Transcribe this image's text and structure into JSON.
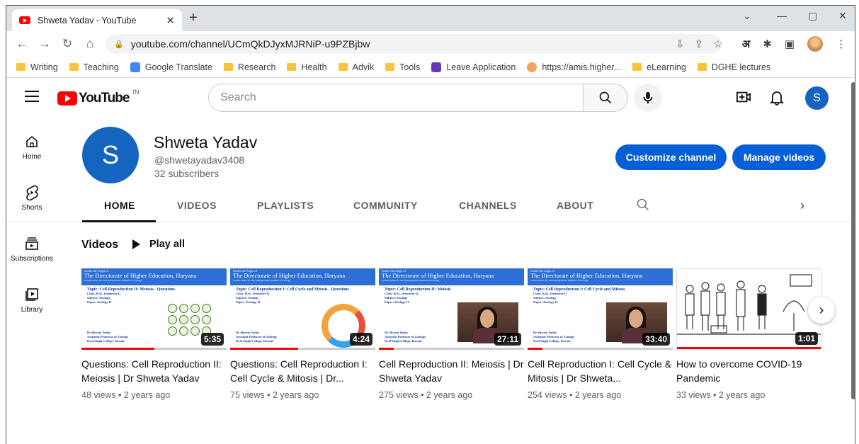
{
  "browser": {
    "tab_title": "Shweta Yadav - YouTube",
    "url": "youtube.com/channel/UCmQkDJyxMJRNiP-u9PZBjbw",
    "ext_lang": "अ",
    "bookmarks": [
      {
        "label": "Writing",
        "icon": "folder-icon"
      },
      {
        "label": "Teaching",
        "icon": "folder-icon"
      },
      {
        "label": "Google Translate",
        "icon": "google-translate-icon"
      },
      {
        "label": "Research",
        "icon": "folder-icon"
      },
      {
        "label": "Health",
        "icon": "folder-icon"
      },
      {
        "label": "Advik",
        "icon": "folder-icon"
      },
      {
        "label": "Tools",
        "icon": "folder-icon"
      },
      {
        "label": "Leave Application",
        "icon": "forms-icon"
      },
      {
        "label": "https://amis.higher...",
        "icon": "site-icon"
      },
      {
        "label": "eLearning",
        "icon": "folder-icon"
      },
      {
        "label": "DGHE lectures",
        "icon": "folder-icon"
      }
    ]
  },
  "header": {
    "logo_text": "YouTube",
    "country_code": "IN",
    "search_placeholder": "Search",
    "user_initial": "S"
  },
  "guide": {
    "items": [
      {
        "label": "Home",
        "icon": "home-icon"
      },
      {
        "label": "Shorts",
        "icon": "shorts-icon"
      },
      {
        "label": "Subscriptions",
        "icon": "subscriptions-icon"
      },
      {
        "label": "Library",
        "icon": "library-icon"
      }
    ]
  },
  "channel": {
    "initial": "S",
    "name": "Shweta Yadav",
    "handle": "@shwetayadav3408",
    "subscribers": "32 subscribers",
    "customize_label": "Customize channel",
    "manage_label": "Manage videos",
    "tabs": [
      "HOME",
      "VIDEOS",
      "PLAYLISTS",
      "COMMUNITY",
      "CHANNELS",
      "ABOUT"
    ],
    "active_tab": "HOME"
  },
  "shelf": {
    "title": "Videos",
    "play_all": "Play all",
    "videos": [
      {
        "title": "Questions: Cell Reproduction II: Meiosis | Dr Shweta Yadav",
        "views": "48 views",
        "age": "2 years ago",
        "duration": "5:35",
        "watched_fraction": 0.5,
        "slide": {
          "org_pre": "Under the Aegis of",
          "org": "The Directorate of Higher Education, Haryana",
          "series": "Lecture Series for the Undergraduate Students of Zoology",
          "topic": "Topic: Cell Reproduction II: Meiosis - Questions",
          "class": "Class: B.Sc. (Semester I)",
          "subject": "Subject: Zoology",
          "paper": "Paper: Zoology II",
          "author": "Dr Shweta Yadav",
          "role": "Assistant Professor of Zoology",
          "college": "Dyal Singh College, Karnal"
        }
      },
      {
        "title": "Questions: Cell Reproduction I: Cell Cycle & Mitosis | Dr...",
        "views": "75 views",
        "age": "2 years ago",
        "duration": "4:24",
        "watched_fraction": 0.47,
        "slide": {
          "org_pre": "Under the Aegis of",
          "org": "The Directorate of Higher Education, Haryana",
          "series": "Lecture Series for the Undergraduate Students of Zoology",
          "topic": "Topic: Cell Reproduction I: Cell Cycle and Mitosis - Questions",
          "class": "Class: B.Sc. (Semester I)",
          "subject": "Subject: Zoology",
          "paper": "Paper: Zoology II",
          "author": "Dr Shweta Yadav",
          "role": "Assistant Professor of Zoology",
          "college": "Dyal Singh College, Karnal"
        }
      },
      {
        "title": "Cell Reproduction II: Meiosis | Dr Shweta Yadav",
        "views": "275 views",
        "age": "2 years ago",
        "duration": "27:11",
        "watched_fraction": 0.1,
        "slide": {
          "org_pre": "Under the Aegis of",
          "org": "The Directorate of Higher Education, Haryana",
          "series": "Lecture Series for the Undergraduate Students of Zoology",
          "topic": "Topic: Cell Reproduction II: Meiosis",
          "class": "Class: B.Sc. (Semester I)",
          "subject": "Subject: Zoology",
          "paper": "Paper: Zoology II",
          "author": "Dr Shweta Yadav",
          "role": "Assistant Professor of Zoology",
          "college": "Dyal Singh College, Karnal"
        }
      },
      {
        "title": "Cell Reproduction I: Cell Cycle & Mitosis | Dr Shweta...",
        "views": "254 views",
        "age": "2 years ago",
        "duration": "33:40",
        "watched_fraction": 0.1,
        "slide": {
          "org_pre": "Under the Aegis of",
          "org": "The Directorate of Higher Education, Haryana",
          "series": "Lecture Series for the Undergraduate Students of Zoology",
          "topic": "Topic: Cell Reproduction I: Cell Cycle and Mitosis",
          "class": "Class: B.Sc. (Semester I)",
          "subject": "Subject: Zoology",
          "paper": "Paper: Zoology II",
          "author": "Dr Shweta Yadav",
          "role": "Assistant Professor of Zoology",
          "college": "Dyal Singh College, Karnal"
        }
      },
      {
        "title": "How to overcome COVID-19 Pandemic",
        "views": "33 views",
        "age": "2 years ago",
        "duration": "1:01",
        "watched_fraction": 1.0
      }
    ]
  },
  "colors": {
    "brand_red": "#ff0000",
    "primary_blue": "#065fd4",
    "avatar_blue": "#1565c0"
  }
}
